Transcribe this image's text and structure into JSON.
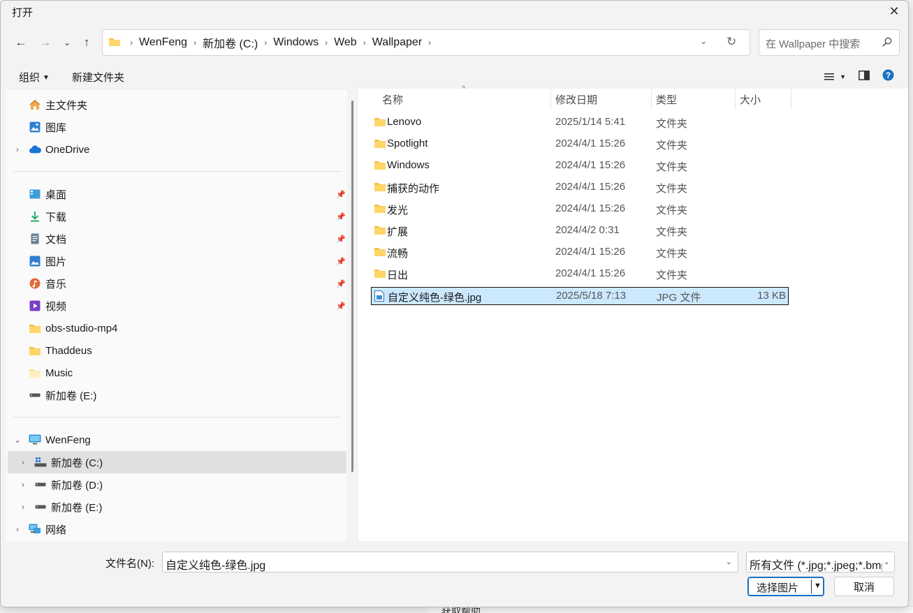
{
  "window": {
    "title": "打开"
  },
  "address": {
    "crumbs": [
      "WenFeng",
      "新加卷 (C:)",
      "Windows",
      "Web",
      "Wallpaper"
    ],
    "search_placeholder": "在 Wallpaper 中搜索"
  },
  "commands": {
    "organize": "组织",
    "new_folder": "新建文件夹"
  },
  "nav_pane": {
    "quick_access": [
      {
        "label": "主文件夹",
        "icon": "home-icon"
      },
      {
        "label": "图库",
        "icon": "gallery-icon"
      },
      {
        "label": "OneDrive",
        "icon": "cloud-icon"
      }
    ],
    "pinned": [
      {
        "label": "桌面",
        "icon": "desktop-icon"
      },
      {
        "label": "下载",
        "icon": "download-icon"
      },
      {
        "label": "文档",
        "icon": "document-icon"
      },
      {
        "label": "图片",
        "icon": "pictures-icon"
      },
      {
        "label": "音乐",
        "icon": "music-icon"
      },
      {
        "label": "视频",
        "icon": "video-icon"
      }
    ],
    "folders": [
      {
        "label": "obs-studio-mp4"
      },
      {
        "label": "Thaddeus"
      },
      {
        "label": "Music"
      },
      {
        "label": "新加卷 (E:)"
      }
    ],
    "this_pc": {
      "label": "WenFeng"
    },
    "drives": [
      {
        "label": "新加卷 (C:)",
        "selected": true
      },
      {
        "label": "新加卷 (D:)"
      },
      {
        "label": "新加卷 (E:)"
      }
    ],
    "network": {
      "label": "网络"
    }
  },
  "file_list": {
    "columns": {
      "name": "名称",
      "date": "修改日期",
      "type": "类型",
      "size": "大小"
    },
    "rows": [
      {
        "name": "Lenovo",
        "date": "2025/1/14 5:41",
        "type": "文件夹",
        "size": "",
        "kind": "folder"
      },
      {
        "name": "Spotlight",
        "date": "2024/4/1 15:26",
        "type": "文件夹",
        "size": "",
        "kind": "folder"
      },
      {
        "name": "Windows",
        "date": "2024/4/1 15:26",
        "type": "文件夹",
        "size": "",
        "kind": "folder"
      },
      {
        "name": "捕获的动作",
        "date": "2024/4/1 15:26",
        "type": "文件夹",
        "size": "",
        "kind": "folder"
      },
      {
        "name": "发光",
        "date": "2024/4/1 15:26",
        "type": "文件夹",
        "size": "",
        "kind": "folder"
      },
      {
        "name": "扩展",
        "date": "2024/4/2 0:31",
        "type": "文件夹",
        "size": "",
        "kind": "folder"
      },
      {
        "name": "流畅",
        "date": "2024/4/1 15:26",
        "type": "文件夹",
        "size": "",
        "kind": "folder"
      },
      {
        "name": "日出",
        "date": "2024/4/1 15:26",
        "type": "文件夹",
        "size": "",
        "kind": "folder"
      },
      {
        "name": "自定义纯色-绿色.jpg",
        "date": "2025/5/18 7:13",
        "type": "JPG 文件",
        "size": "13 KB",
        "kind": "image",
        "selected": true
      }
    ]
  },
  "bottom": {
    "filename_label": "文件名(N):",
    "filename_value": "自定义纯色-绿色.jpg",
    "filetype_value": "所有文件 (*.jpg;*.jpeg;*.bmp;*.png)",
    "open_button": "选择图片",
    "cancel_button": "取消"
  },
  "background": {
    "partial_text": "获取帮助"
  },
  "colors": {
    "accent": "#1a6fc2",
    "selection": "#cce8ff",
    "folder": "#f4c046"
  }
}
